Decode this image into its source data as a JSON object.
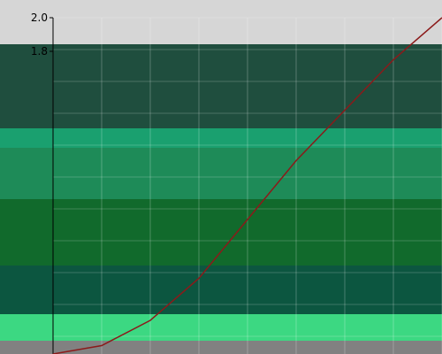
{
  "chart_data": {
    "type": "line",
    "x": [
      0,
      0.5,
      1,
      1.5,
      2,
      2.5,
      3,
      3.5,
      4
    ],
    "y": [
      0.0,
      0.05,
      0.2,
      0.45,
      0.8,
      1.15,
      1.45,
      1.75,
      2.0
    ],
    "ylim": [
      0.0,
      2.0
    ],
    "yticks": [
      "2.0",
      "1.8"
    ],
    "grid": true,
    "series": [
      {
        "values": [
          0.0,
          0.05,
          0.2,
          0.45,
          0.8,
          1.15,
          1.45,
          1.75,
          2.0
        ],
        "color": "#8b1a1a"
      }
    ]
  }
}
